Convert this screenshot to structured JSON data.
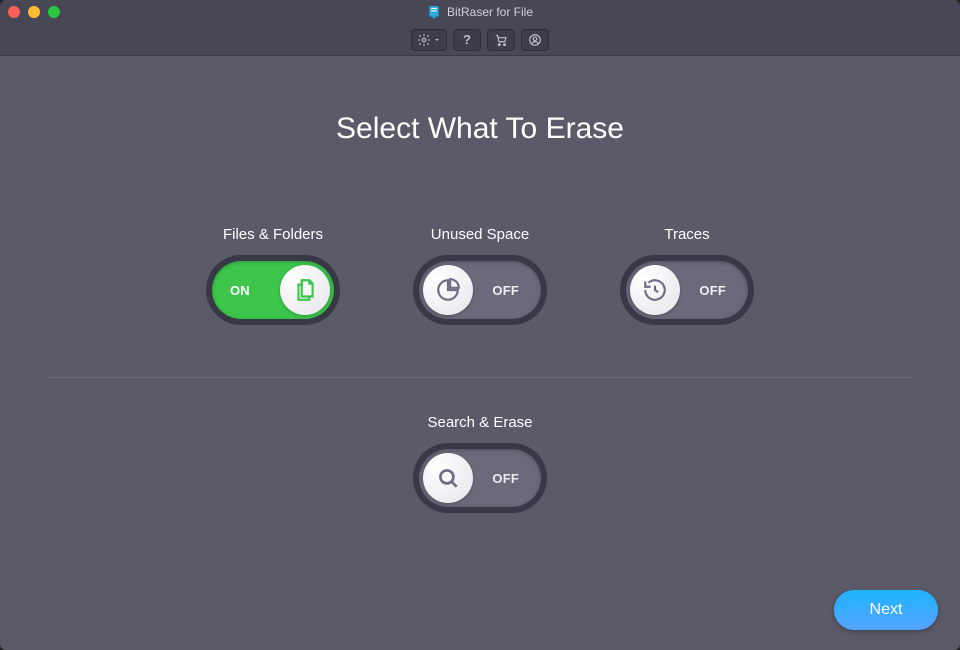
{
  "app": {
    "title": "BitRaser for File"
  },
  "headline": "Select What To Erase",
  "options": {
    "files": {
      "label": "Files & Folders",
      "on": true,
      "state": "ON"
    },
    "unused": {
      "label": "Unused Space",
      "on": false,
      "state": "OFF"
    },
    "traces": {
      "label": "Traces",
      "on": false,
      "state": "OFF"
    },
    "search": {
      "label": "Search & Erase",
      "on": false,
      "state": "OFF"
    }
  },
  "buttons": {
    "next": "Next"
  },
  "colors": {
    "accent_green": "#3dc64b",
    "next_gradient_top": "#1fb4ff",
    "next_gradient_bottom": "#55a4ff",
    "background": "#5a5a69"
  }
}
